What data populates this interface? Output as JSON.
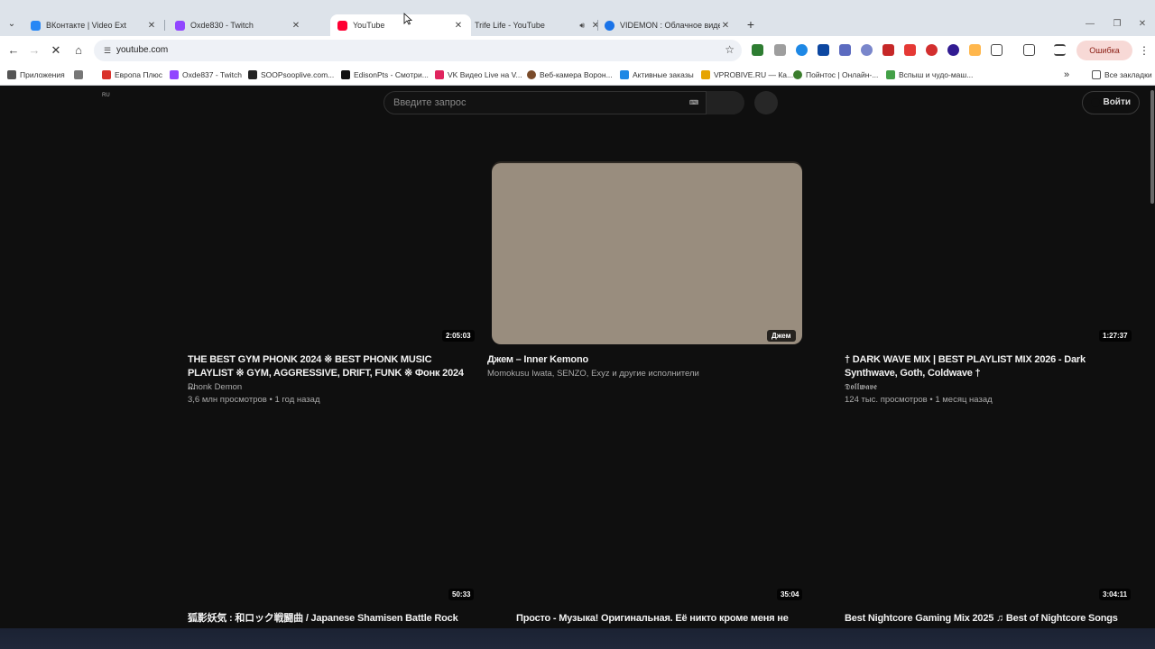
{
  "browser": {
    "tabs": [
      {
        "title": "ВКонтакте | Video Ext",
        "favicon_color": "#2787f5",
        "active": false
      },
      {
        "title": "Oxde830 - Twitch",
        "favicon_color": "#9146ff",
        "active": false
      },
      {
        "title": "YouTube",
        "favicon_color": "#ff0033",
        "active": true
      },
      {
        "title": "Trife Life - YouTube",
        "favicon_color": "#ff0033",
        "active": false,
        "audio": true
      },
      {
        "title": "VIDEMON : Облачное видеон",
        "favicon_color": "#1a73e8",
        "active": false
      }
    ],
    "newtab_label": "+",
    "address": "youtube.com",
    "error_label": "Ошибка",
    "bookmarks": [
      {
        "label": "Приложения",
        "color": "#555555"
      },
      {
        "label": "Европа Плюс",
        "color": "#d9322b"
      },
      {
        "label": "Oxde837 - Twitch",
        "color": "#9146ff"
      },
      {
        "label": "SOOPsooplive.com...",
        "color": "#222222"
      },
      {
        "label": "EdisonPts - Смотри...",
        "color": "#111111"
      },
      {
        "label": "VK Видео Live на V...",
        "color": "#e0245e"
      },
      {
        "label": "Веб-камера Ворон...",
        "color": "#7a4b2a"
      },
      {
        "label": "Активные заказы",
        "color": "#1e88e5"
      },
      {
        "label": "VPROBIVE.RU — Ка...",
        "color": "#e6a400"
      },
      {
        "label": "Пойнтос | Онлайн-...",
        "color": "#3a7d2c"
      },
      {
        "label": "Вспыш и чудо-маш...",
        "color": "#43a047"
      }
    ],
    "bookmarks_overflow": "»",
    "all_bookmarks_label": "Все закладки"
  },
  "youtube": {
    "locale": "RU",
    "search_placeholder": "Введите запрос",
    "signin_label": "Войти",
    "videos": [
      {
        "title": "THE BEST GYM PHONK 2024 ※ BEST PHONK MUSIC PLAYLIST ※ GYM, AGGRESSIVE, DRIFT, FUNK ※ Фонк 2024 ...",
        "channel": "Phonk Demon",
        "meta": "3,6 млн просмотров • 1 год назад",
        "duration": "2:05:03",
        "thumb_loaded": false
      },
      {
        "title": "Джем – Inner Kemono",
        "channel": "Momokusu Iwata, SENZO, Exyz и другие исполнители",
        "meta": "",
        "duration": "Джем",
        "thumb_loaded": true
      },
      {
        "title": "† DARK WAVE MIX | BEST PLAYLIST MIX 2026 - Dark Synthwave, Goth, Coldwave †",
        "channel": "𝕯𝖔𝖑𝖑𝖜𝖆𝖛𝖊",
        "meta": "124 тыс. просмотров • 1 месяц назад",
        "duration": "1:27:37",
        "thumb_loaded": false
      },
      {
        "title": "狐影妖気 : 和ロック戦闘曲 / Japanese Shamisen Battle Rock",
        "channel": "",
        "meta": "",
        "duration": "50:33",
        "thumb_loaded": false
      },
      {
        "title": "Просто - Музыка! Оригинальная. Её никто кроме меня не",
        "channel": "",
        "meta": "",
        "duration": "35:04",
        "thumb_loaded": false
      },
      {
        "title": "Best Nightcore Gaming Mix 2025 ♫ Best of Nightcore Songs",
        "channel": "",
        "meta": "",
        "duration": "3:04:11",
        "thumb_loaded": false
      }
    ]
  },
  "colors": {
    "page_bg": "#0f0f0f",
    "tabstrip_bg": "#dde3ea",
    "thumb_placeholder": "#998d7e"
  }
}
